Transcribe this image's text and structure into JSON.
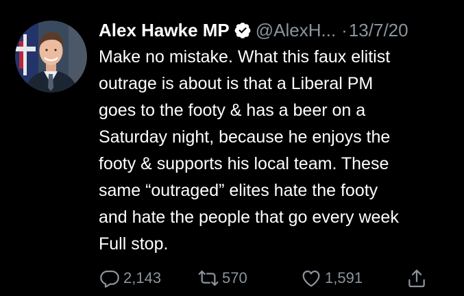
{
  "tweet": {
    "author": {
      "display_name": "Alex Hawke MP",
      "handle": "@AlexH...",
      "verified": true,
      "avatar_icon": "profile-photo"
    },
    "separator": "·",
    "date": "13/7/20",
    "body_lines": [
      "Make no mistake. What this faux elitist",
      "outrage is about is that a Liberal PM",
      "goes to the footy & has a beer on a",
      "Saturday night, because he enjoys the",
      "footy & supports his local team.  These",
      "same “outraged” elites hate the footy",
      "and hate the people that go every week",
      "Full stop."
    ],
    "actions": {
      "reply": {
        "icon": "reply-icon",
        "count": "2,143"
      },
      "retweet": {
        "icon": "retweet-icon",
        "count": "570"
      },
      "like": {
        "icon": "like-icon",
        "count": "1,591"
      },
      "share": {
        "icon": "share-icon"
      }
    }
  },
  "colors": {
    "background": "#000000",
    "text": "#ffffff",
    "secondary_text": "#8b949e",
    "verified_badge": "#ffffff"
  }
}
